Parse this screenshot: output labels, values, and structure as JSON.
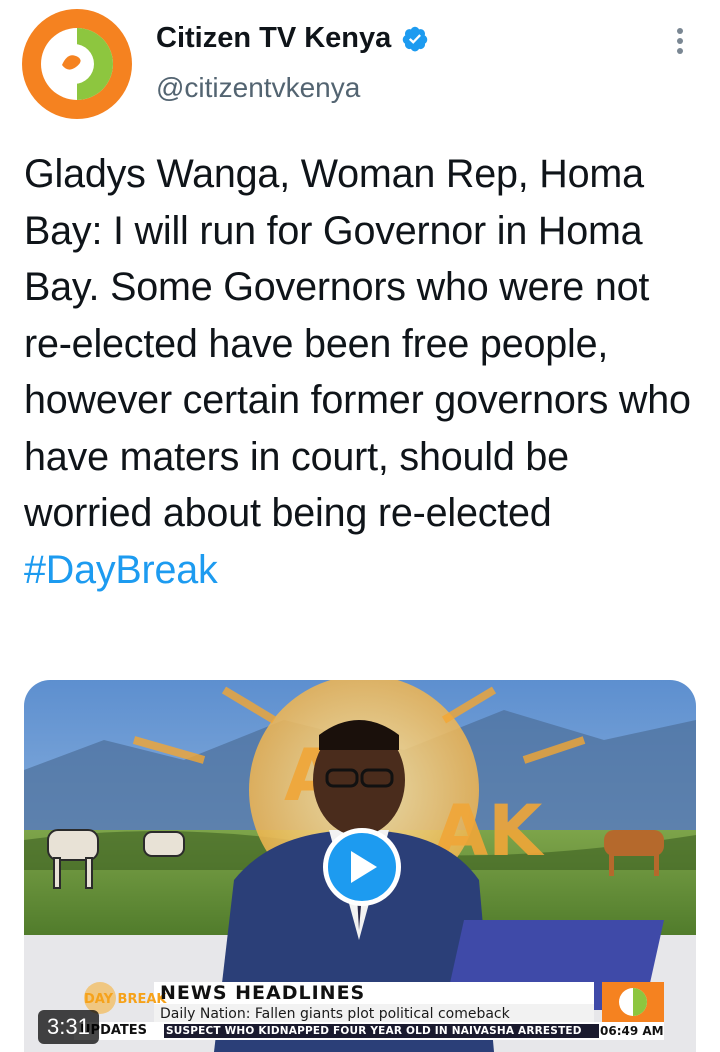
{
  "account": {
    "display_name": "Citizen TV Kenya",
    "handle": "@citizentvkenya",
    "verified": true,
    "avatar_icon": "citizen-tv-logo"
  },
  "tweet": {
    "text": "Gladys Wanga, Woman Rep, Homa Bay: I will run for Governor in Homa Bay. Some Governors who were not re-elected have been free people, however certain former governors who have maters in court, should be worried about being re-elected",
    "hashtag": "#DayBreak"
  },
  "media": {
    "duration": "3:31",
    "show_logo": "DAY BREAK",
    "lower_third": {
      "headline": "NEWS HEADLINES",
      "subline": "Daily Nation: Fallen giants plot political comeback",
      "updates_label": "UPDATES",
      "ticker": "SUSPECT WHO KIDNAPPED FOUR YEAR OLD IN NAIVASHA ARRESTED",
      "clock": "06:49 AM"
    }
  },
  "colors": {
    "link": "#1d9bf0",
    "verified": "#1d9bf0",
    "logo_orange": "#f58220",
    "logo_green": "#8dc63f"
  }
}
